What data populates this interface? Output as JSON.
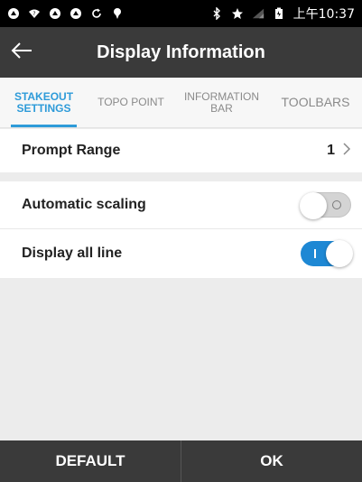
{
  "status_bar": {
    "left_icons": [
      "app-notification-icon",
      "wifi-question-icon",
      "app-notification-icon",
      "app-notification-icon",
      "sync-icon",
      "location-pin-icon"
    ],
    "right_icons": [
      "bluetooth-icon",
      "star-icon",
      "signal-icon",
      "battery-icon"
    ],
    "time": "上午10:37"
  },
  "app_bar": {
    "title": "Display Information"
  },
  "tabs": [
    {
      "label": "STAKEOUT SETTINGS",
      "active": true
    },
    {
      "label": "TOPO POINT",
      "active": false
    },
    {
      "label": "INFORMATION BAR",
      "active": false
    },
    {
      "label": "TOOLBARS",
      "active": false
    }
  ],
  "settings": {
    "prompt_range": {
      "label": "Prompt Range",
      "value": "1"
    },
    "automatic_scaling": {
      "label": "Automatic scaling",
      "enabled": false
    },
    "display_all_line": {
      "label": "Display all line",
      "enabled": true
    }
  },
  "bottom_bar": {
    "default_label": "DEFAULT",
    "ok_label": "OK"
  },
  "colors": {
    "accent": "#2e9bd9",
    "toggle_on": "#1e88d4",
    "app_bar": "#3a3a3a"
  }
}
